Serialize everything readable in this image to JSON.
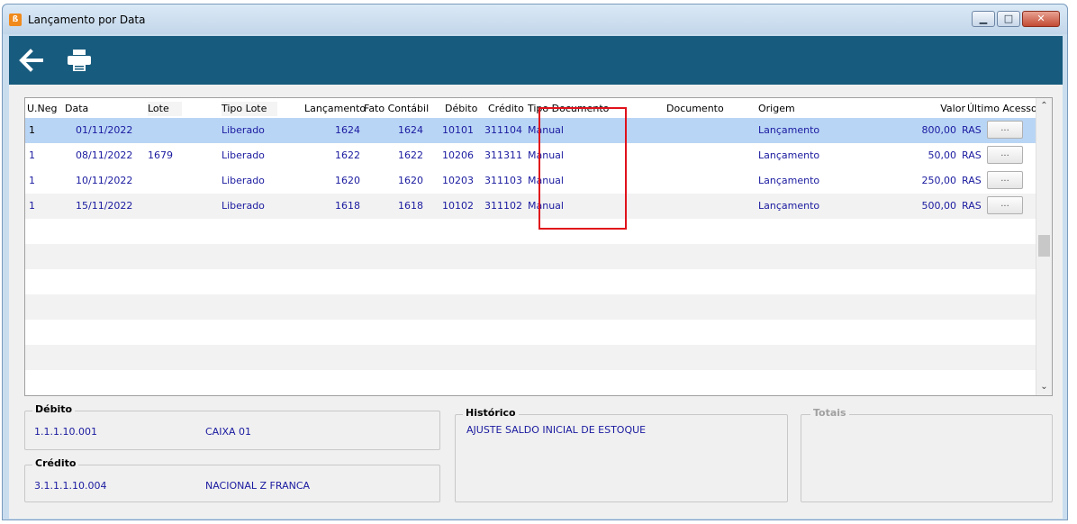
{
  "window": {
    "title": "Lançamento por Data",
    "icon": "app-logo-icon",
    "buttons": [
      "minimize",
      "maximize",
      "close"
    ]
  },
  "toolbar": {
    "back_icon": "arrow-left-icon",
    "print_icon": "printer-icon",
    "accent_color": "#175b7e"
  },
  "grid": {
    "columns": [
      "U.Neg",
      "Data",
      "Lote",
      "Tipo Lote",
      "Lançamento",
      "Fato Contábil",
      "Débito",
      "Crédito",
      "Tipo Documento",
      "Documento",
      "Origem",
      "Valor",
      "Último Acesso"
    ],
    "rows": [
      {
        "uneg": "1",
        "data": "01/11/2022",
        "lote": "",
        "tipo_lote": "Liberado",
        "lancamento": "1624",
        "fato": "1624",
        "debito": "10101",
        "credito": "311104",
        "tipo_doc": "Manual",
        "documento": "",
        "origem": "Lançamento",
        "valor": "800,00",
        "ultimo": "RAS",
        "more": "..."
      },
      {
        "uneg": "1",
        "data": "08/11/2022",
        "lote": "1679",
        "tipo_lote": "Liberado",
        "lancamento": "1622",
        "fato": "1622",
        "debito": "10206",
        "credito": "311311",
        "tipo_doc": "Manual",
        "documento": "",
        "origem": "Lançamento",
        "valor": "50,00",
        "ultimo": "RAS",
        "more": "..."
      },
      {
        "uneg": "1",
        "data": "10/11/2022",
        "lote": "",
        "tipo_lote": "Liberado",
        "lancamento": "1620",
        "fato": "1620",
        "debito": "10203",
        "credito": "311103",
        "tipo_doc": "Manual",
        "documento": "",
        "origem": "Lançamento",
        "valor": "250,00",
        "ultimo": "RAS",
        "more": "..."
      },
      {
        "uneg": "1",
        "data": "15/11/2022",
        "lote": "",
        "tipo_lote": "Liberado",
        "lancamento": "1618",
        "fato": "1618",
        "debito": "10102",
        "credito": "311102",
        "tipo_doc": "Manual",
        "documento": "",
        "origem": "Lançamento",
        "valor": "500,00",
        "ultimo": "RAS",
        "more": "..."
      }
    ],
    "highlight_color": "#e0121b"
  },
  "debito": {
    "title": "Débito",
    "code": "1.1.1.10.001",
    "name": "CAIXA 01"
  },
  "credito": {
    "title": "Crédito",
    "code": "3.1.1.1.10.004",
    "name": "NACIONAL Z FRANCA"
  },
  "historico": {
    "title": "Histórico",
    "text": "AJUSTE SALDO INICIAL DE ESTOQUE"
  },
  "totais": {
    "title": "Totais"
  }
}
